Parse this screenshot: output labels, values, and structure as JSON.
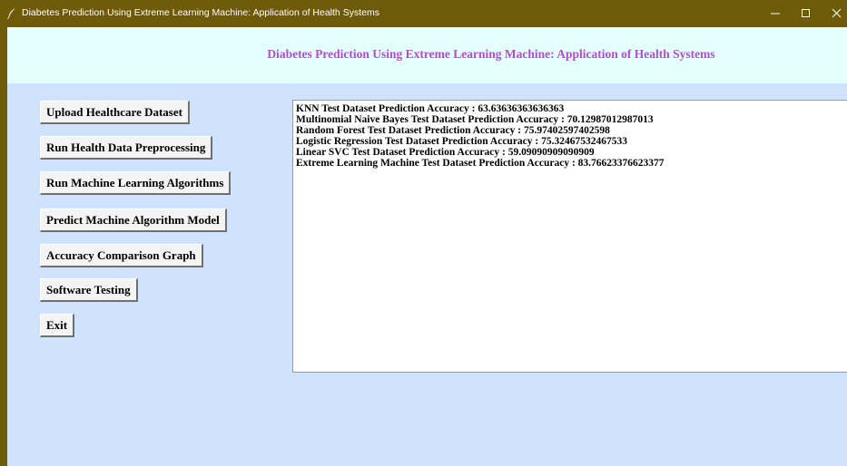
{
  "window": {
    "title": "Diabetes Prediction Using Extreme Learning Machine: Application of Health Systems",
    "app_icon": "feather-icon",
    "controls": [
      "minimize-icon",
      "maximize-icon",
      "close-icon"
    ]
  },
  "header": {
    "title": "Diabetes Prediction Using Extreme Learning Machine: Application of Health Systems"
  },
  "buttons": {
    "upload": "Upload Healthcare Dataset",
    "preprocess": "Run Health Data Preprocessing",
    "run_ml": "Run Machine Learning Algorithms",
    "predict": "Predict Machine Algorithm Model",
    "accuracy_graph": "Accuracy Comparison Graph",
    "testing": "Software Testing",
    "exit": "Exit"
  },
  "output": {
    "lines": [
      "KNN Test Dataset Prediction Accuracy : 63.63636363636363",
      "Multinomial Naive Bayes Test Dataset Prediction Accuracy : 70.12987012987013",
      "Random Forest Test Dataset Prediction Accuracy : 75.97402597402598",
      "Logistic Regression Test Dataset Prediction Accuracy : 75.32467532467533",
      "Linear SVC Test Dataset Prediction Accuracy : 59.09090909090909",
      "Extreme Learning Machine Test Dataset Prediction Accuracy : 83.76623376623377"
    ]
  },
  "colors": {
    "titlebar": "#6e5a09",
    "header_band": "#e4fdff",
    "header_text": "#b14fc8",
    "client_background": "#cfe3ff",
    "button_face": "#f4f4f4",
    "output_background": "#ffffff"
  }
}
